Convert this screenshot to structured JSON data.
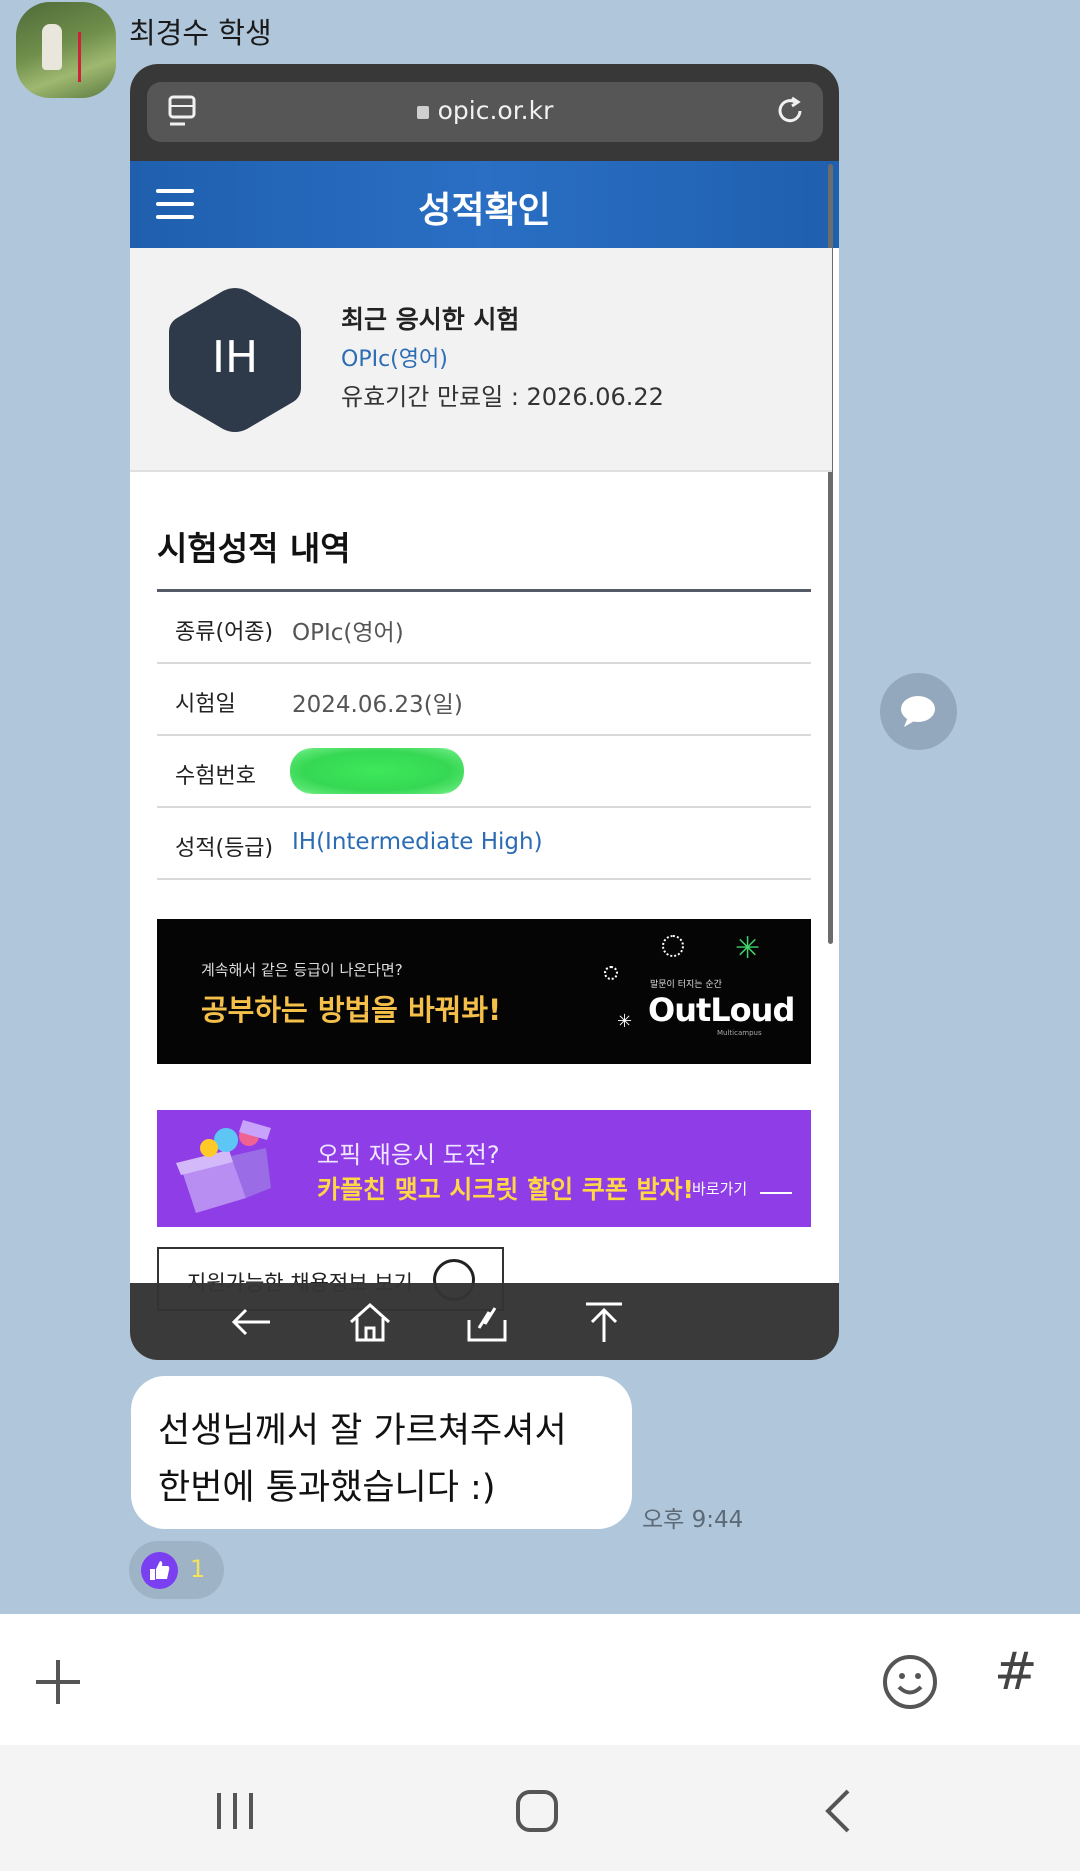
{
  "chat": {
    "sender_name": "최경수 학생",
    "message_lines": [
      "선생님께서 잘 가르쳐주셔서",
      "한번에 통과했습니다 :)"
    ],
    "time": "오후 9:44",
    "reaction_count": "1"
  },
  "screenshot": {
    "url": "opic.or.kr",
    "page_title": "성적확인",
    "grade_badge": "IH",
    "recent_title": "최근 응시한 시험",
    "recent_type": "OPIc(영어)",
    "recent_expiry": "유효기간 만료일 : 2026.06.22",
    "section_title": "시험성적 내역",
    "rows": [
      {
        "label": "종류(어종)",
        "value": "OPIc(영어)"
      },
      {
        "label": "시험일",
        "value": "2024.06.23(일)"
      },
      {
        "label": "수험번호",
        "value": ""
      },
      {
        "label": "성적(등급)",
        "value": "IH(Intermediate High)"
      }
    ],
    "banner1": {
      "sub": "계속해서 같은 등급이 나온다면?",
      "main": "공부하는 방법을 바꿔봐!",
      "tiny": "말문이 터지는 순간",
      "brand": "OutLoud",
      "brand_sub": "Multicampus"
    },
    "banner2": {
      "question": "오픽 재응시 도전?",
      "main": "카플친 맺고 시크릿 할인 쿠폰 받자!",
      "go": "바로가기"
    },
    "jobs_button": "지원가능한 채용정보 보기"
  },
  "colors": {
    "chat_bg": "#afc6db",
    "header_blue": "#2a6fc4",
    "badge_navy": "#2e3a4a",
    "link_blue": "#2b6cb4",
    "banner_yellow": "#f5c04a",
    "banner_purple": "#8f3de6",
    "reaction_purple": "#7a3ff0"
  },
  "icons": [
    "tabs-icon",
    "lock-icon",
    "reload-icon",
    "menu-icon",
    "back-arrow-icon",
    "home-icon",
    "share-icon",
    "scroll-top-icon",
    "share-bubble-icon",
    "thumbs-up-icon",
    "plus-icon",
    "emoji-icon",
    "hashtag-icon",
    "recents-icon",
    "home-nav-icon",
    "back-nav-icon"
  ]
}
